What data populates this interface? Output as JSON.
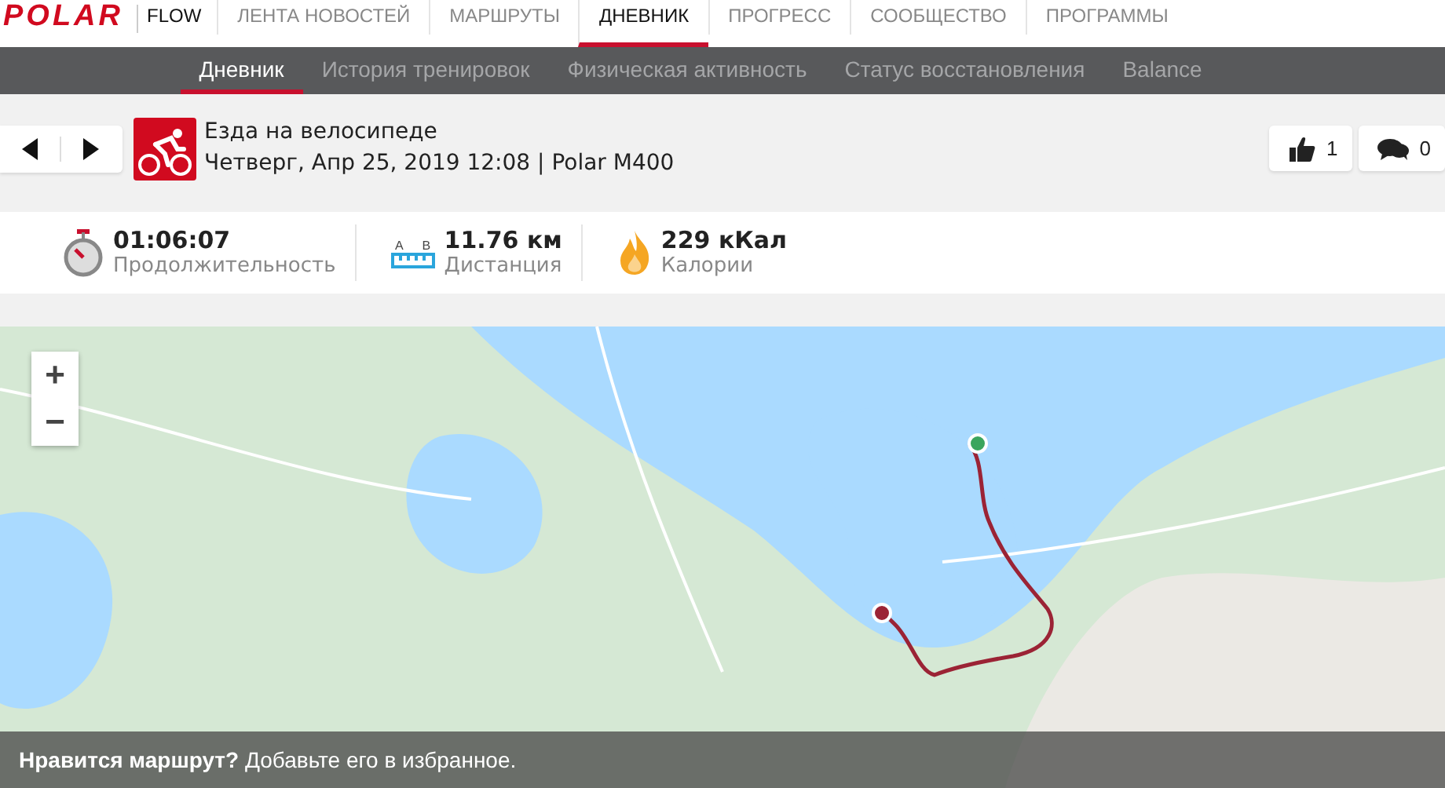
{
  "brand": {
    "logo": "POLAR",
    "product": "FLOW"
  },
  "nav": [
    {
      "label": "ЛЕНТА НОВОСТЕЙ",
      "selected": false
    },
    {
      "label": "МАРШРУТЫ",
      "selected": false
    },
    {
      "label": "ДНЕВНИК",
      "selected": true
    },
    {
      "label": "ПРОГРЕСС",
      "selected": false
    },
    {
      "label": "СООБЩЕСТВО",
      "selected": false
    },
    {
      "label": "ПРОГРАММЫ",
      "selected": false
    }
  ],
  "subnav": [
    {
      "label": "Дневник",
      "selected": true
    },
    {
      "label": "История тренировок",
      "selected": false
    },
    {
      "label": "Физическая активность",
      "selected": false
    },
    {
      "label": "Статус восстановления",
      "selected": false
    },
    {
      "label": "Balance",
      "selected": false
    }
  ],
  "session": {
    "title": "Езда на велосипеде",
    "subtitle": "Четверг, Апр 25, 2019 12:08 | Polar M400",
    "likes": "1",
    "comments": "0"
  },
  "stats": [
    {
      "kind": "duration",
      "value": "01:06:07",
      "label": "Продолжительность"
    },
    {
      "kind": "distance",
      "value": "11.76 км",
      "label": "Дистанция",
      "marks": [
        "A",
        "B"
      ]
    },
    {
      "kind": "calories",
      "value": "229 кКал",
      "label": "Калории"
    }
  ],
  "map": {
    "zoom_in": "+",
    "zoom_out": "−",
    "banner_bold": "Нравится маршрут?",
    "banner_text": "Добавьте его в избранное."
  }
}
